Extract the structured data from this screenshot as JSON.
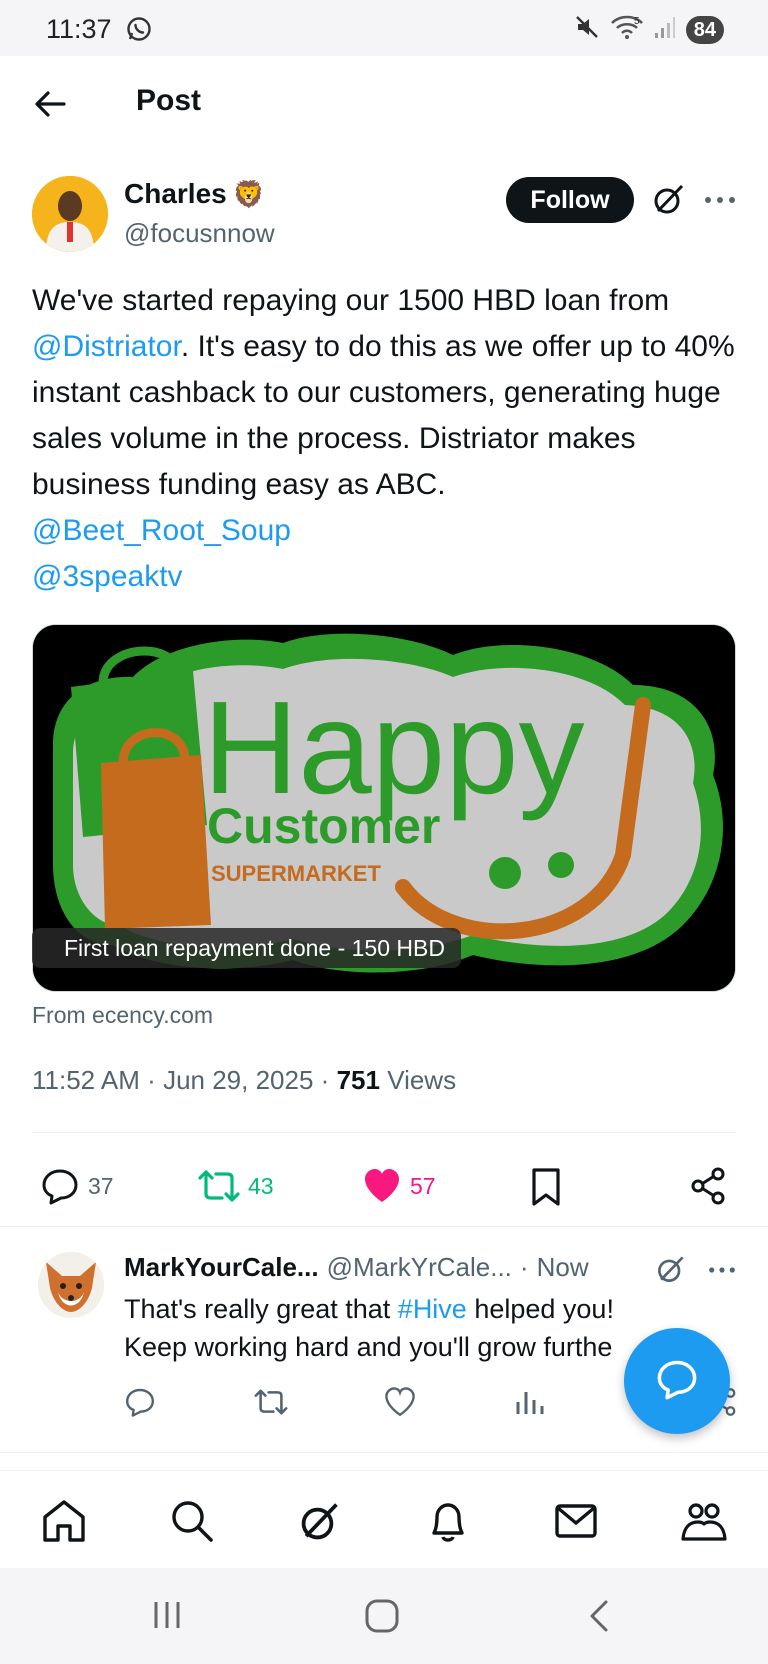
{
  "status_bar": {
    "time": "11:37",
    "battery": "84",
    "signal_label": "5"
  },
  "header": {
    "title": "Post"
  },
  "post": {
    "author_name": "Charles",
    "author_emoji": "🦁",
    "author_handle": "@focusnnow",
    "follow_label": "Follow",
    "text_segments": [
      {
        "text": "We've started repaying our 1500 HBD loan from ",
        "link": false
      },
      {
        "text": "@Distriator",
        "link": true
      },
      {
        "text": ". It's easy to do this as we offer up to 40% instant cashback to our customers, generating huge sales volume in the process. Distriator makes business funding easy as ABC.",
        "link": false
      }
    ],
    "mentions": [
      "@Beet_Root_Soup",
      "@3speaktv"
    ],
    "media": {
      "logo_word_1": "Happy",
      "logo_word_2": "Customer",
      "logo_word_3": "SUPERMARKET",
      "caption": "First loan repayment done - 150 HBD"
    },
    "source": "From ecency.com",
    "time": "11:52 AM",
    "date": "Jun 29, 2025",
    "views_count": "751",
    "views_label": "Views",
    "stats": {
      "replies": "37",
      "reposts": "43",
      "likes": "57"
    },
    "colors": {
      "link": "#1d9bf0",
      "repost": "#00ba7c",
      "like": "#f91880"
    }
  },
  "reply": {
    "name": "MarkYourCale...",
    "handle": "@MarkYrCale...",
    "separator": "·",
    "time": "Now",
    "text_before": "That's really great that ",
    "hashtag": "#Hive",
    "text_after": " helped you!",
    "line2": "Keep working hard and you'll grow furthe"
  },
  "bottom_nav": [
    "home-icon",
    "search-icon",
    "grok-icon",
    "notifications-icon",
    "messages-icon",
    "communities-icon"
  ]
}
